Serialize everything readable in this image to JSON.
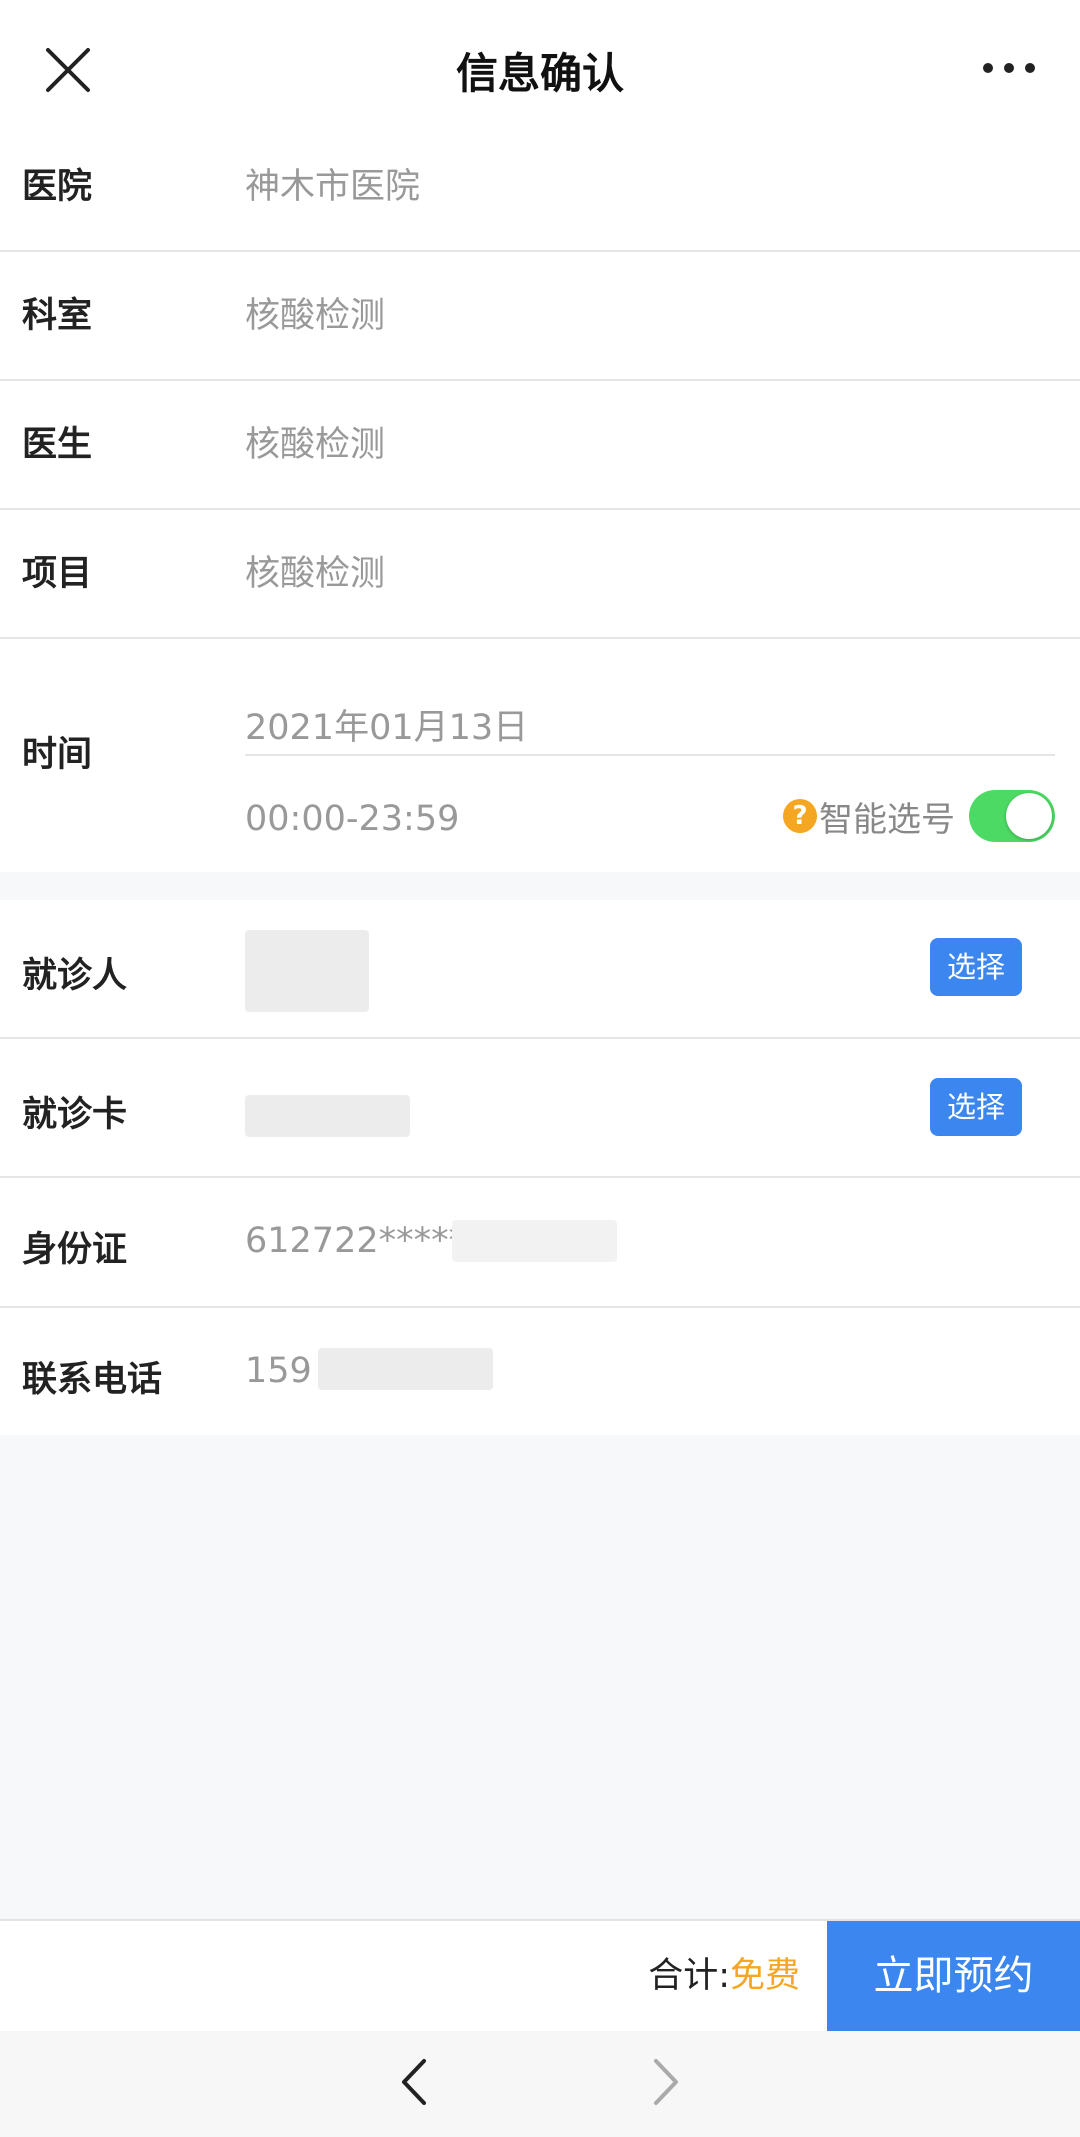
{
  "header": {
    "title": "信息确认"
  },
  "info_rows": [
    {
      "label": "医院",
      "value": "神木市医院"
    },
    {
      "label": "科室",
      "value": "核酸检测"
    },
    {
      "label": "医生",
      "value": "核酸检测"
    },
    {
      "label": "项目",
      "value": "核酸检测"
    }
  ],
  "time": {
    "label": "时间",
    "date": "2021年01月13日",
    "range": "00:00-23:59",
    "smart_help": "?",
    "smart_label": "智能选号",
    "smart_enabled": true
  },
  "patient": {
    "person_label": "就诊人",
    "person_select": "选择",
    "card_label": "就诊卡",
    "card_select": "选择",
    "id_label": "身份证",
    "id_value": "612722*****",
    "phone_label": "联系电话",
    "phone_value": "159"
  },
  "footer": {
    "total_label": "合计:",
    "total_value": "免费",
    "book_button": "立即预约"
  },
  "colors": {
    "accent": "#3b86ef",
    "toggle_on": "#4cd964",
    "price": "#f5a623"
  }
}
